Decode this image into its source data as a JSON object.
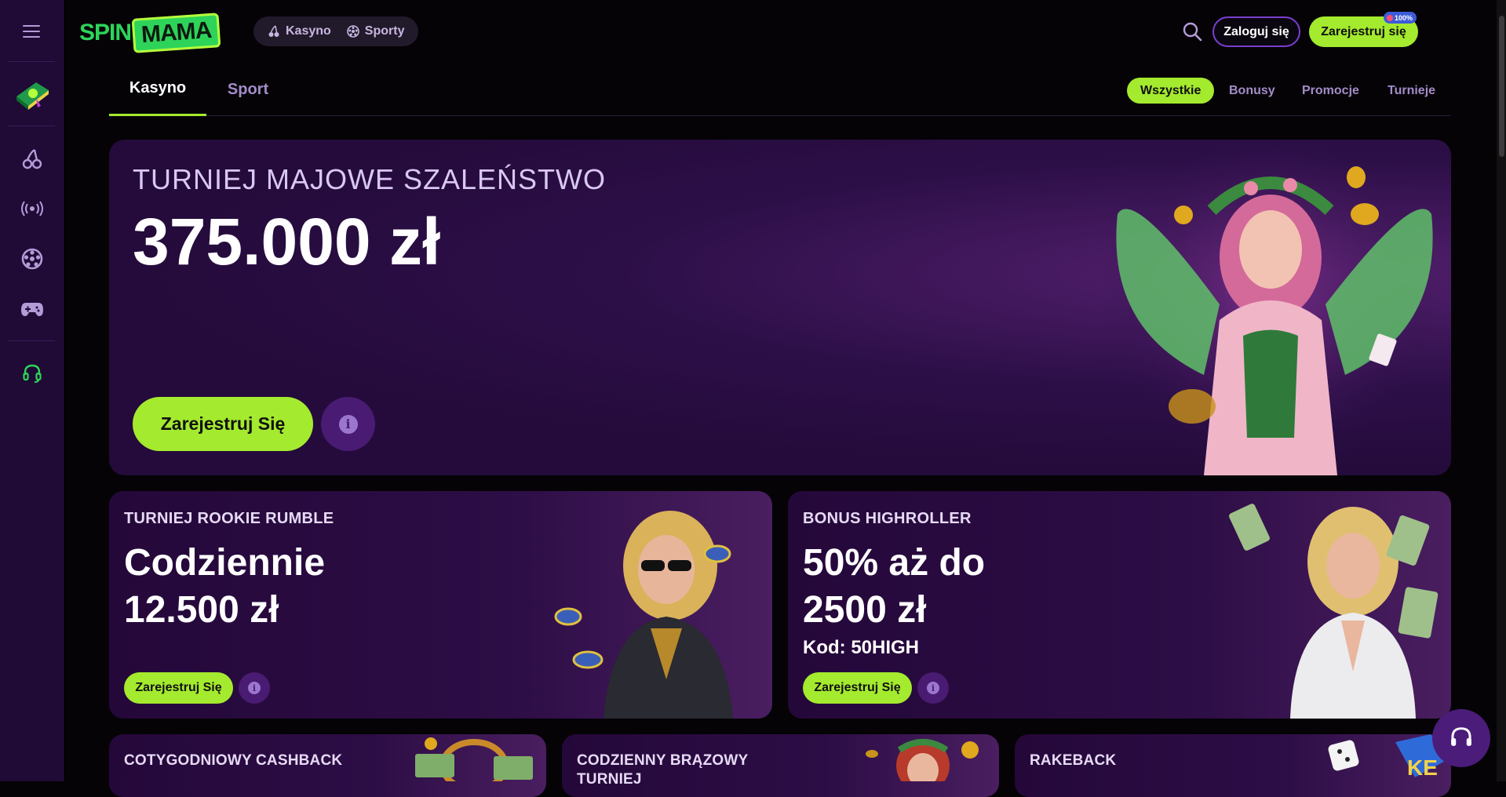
{
  "brand": {
    "logo_left": "SPIN",
    "logo_right": "MAMA"
  },
  "nav": {
    "casino": "Kasyno",
    "sports": "Sporty"
  },
  "header": {
    "login": "Zaloguj się",
    "register": "Zarejestruj się",
    "badge": "100%"
  },
  "tabs": {
    "casino": "Kasyno",
    "sport": "Sport"
  },
  "filters": [
    "Wszystkie",
    "Bonusy",
    "Promocje",
    "Turnieje"
  ],
  "hero": {
    "subtitle": "TURNIEJ MAJOWE SZALEŃSTWO",
    "title": "375.000 zł",
    "button": "Zarejestruj Się"
  },
  "cards": [
    {
      "subtitle": "TURNIEJ ROOKIE RUMBLE",
      "title_line1": "Codziennie",
      "title_line2": "12.500 zł",
      "button": "Zarejestruj Się"
    },
    {
      "subtitle": "BONUS HIGHROLLER",
      "title_line1": "50% aż do",
      "title_line2": "2500 zł",
      "code": "Kod: 50HIGH",
      "button": "Zarejestruj Się"
    }
  ],
  "bottom_cards": [
    "COTYGODNIOWY CASHBACK",
    "CODZIENNY BRĄZOWY TURNIEJ",
    "RAKEBACK"
  ],
  "colors": {
    "accent": "#a4ea2e",
    "sidebar": "#1f0b35",
    "card": "#2c0d45",
    "purple": "#7b3fd0"
  },
  "icons": [
    "menu-icon",
    "cherry-icon",
    "live-icon",
    "football-icon",
    "gamepad-icon",
    "headset-icon",
    "search-icon",
    "info-icon"
  ]
}
